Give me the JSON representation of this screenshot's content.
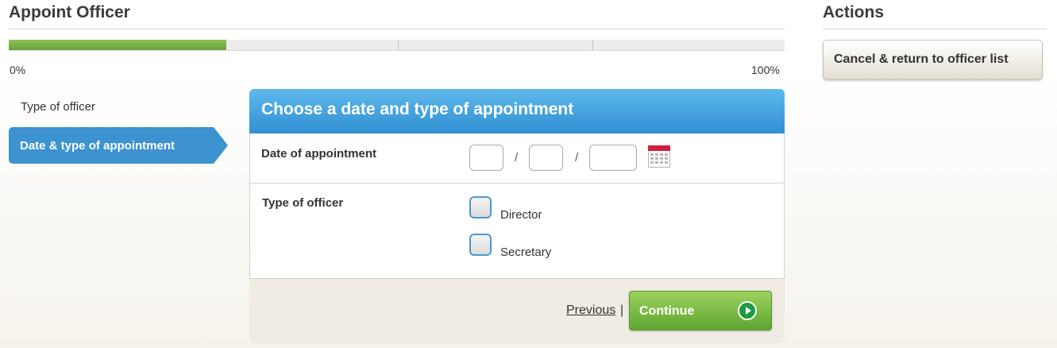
{
  "page_title": "Appoint Officer",
  "progress": {
    "value_percent": 28,
    "start_label": "0%",
    "end_label": "100%",
    "fill_color": "#7ab648"
  },
  "steps": [
    {
      "label": "Type of officer",
      "active": false
    },
    {
      "label": "Date & type of appointment",
      "active": true
    }
  ],
  "form": {
    "header": "Choose a date and type of appointment",
    "date": {
      "label": "Date of appointment",
      "day": "",
      "month": "",
      "year": "",
      "separator": "/",
      "calendar_icon": "calendar-icon"
    },
    "officer_type": {
      "label": "Type of officer",
      "options": [
        {
          "label": "Director",
          "checked": false
        },
        {
          "label": "Secretary",
          "checked": false
        }
      ]
    },
    "previous_label": "Previous",
    "separator": "|",
    "continue_label": "Continue"
  },
  "actions": {
    "title": "Actions",
    "cancel_label": "Cancel & return to officer list"
  },
  "colors": {
    "accent_blue": "#3d92d0",
    "continue_green": "#6fb23e"
  }
}
